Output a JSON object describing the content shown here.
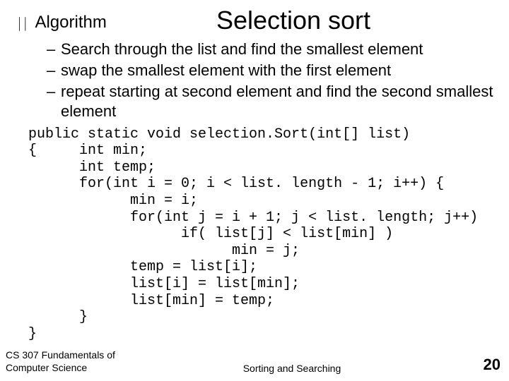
{
  "title": "Selection sort",
  "bullet": "Algorithm",
  "steps": [
    "Search through the list and find the smallest element",
    "swap the smallest element with the first element",
    "repeat starting at second element and find the second smallest element"
  ],
  "code": "public static void selection.Sort(int[] list)\n{     int min;\n      int temp;\n      for(int i = 0; i < list. length - 1; i++) {\n            min = i;\n            for(int j = i + 1; j < list. length; j++)\n                  if( list[j] < list[min] )\n                        min = j;\n            temp = list[i];\n            list[i] = list[min];\n            list[min] = temp;\n      }\n}",
  "footer": {
    "left": "CS 307 Fundamentals of Computer Science",
    "center": "Sorting and Searching",
    "page": "20"
  }
}
